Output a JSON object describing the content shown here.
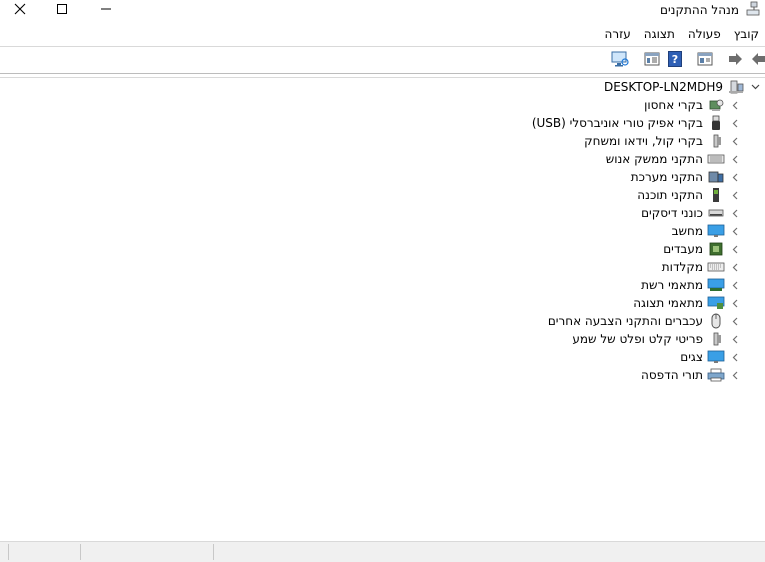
{
  "window": {
    "title": "מנהל ההתקנים",
    "icons": {
      "app": "device-manager-icon",
      "close": "close-icon",
      "maximize": "maximize-icon",
      "minimize": "minimize-icon"
    }
  },
  "menu": {
    "items": [
      "קובץ",
      "פעולה",
      "תצוגה",
      "עזרה"
    ]
  },
  "toolbar": {
    "icons": [
      "back-icon",
      "forward-icon",
      "properties-icon",
      "help-icon",
      "properties-pane-icon",
      "scan-hardware-icon"
    ]
  },
  "tree": {
    "root": {
      "label": "DESKTOP-LN2MDH9",
      "icon": "computer-icon",
      "expanded": true
    },
    "categories": [
      {
        "label": "בקרי אחסון",
        "icon": "storage-controller-icon"
      },
      {
        "label": "בקרי אפיק טורי אוניברסלי (USB)",
        "icon": "usb-icon"
      },
      {
        "label": "בקרי קול, וידאו ומשחק",
        "icon": "speaker-icon"
      },
      {
        "label": "התקני ממשק אנוש",
        "icon": "hid-icon"
      },
      {
        "label": "התקני מערכת",
        "icon": "system-device-icon"
      },
      {
        "label": "התקני תוכנה",
        "icon": "software-device-icon"
      },
      {
        "label": "כונני דיסקים",
        "icon": "disk-drive-icon"
      },
      {
        "label": "מחשב",
        "icon": "monitor-icon"
      },
      {
        "label": "מעבדים",
        "icon": "processor-icon"
      },
      {
        "label": "מקלדות",
        "icon": "keyboard-icon"
      },
      {
        "label": "מתאמי רשת",
        "icon": "network-adapter-icon"
      },
      {
        "label": "מתאמי תצוגה",
        "icon": "display-adapter-icon"
      },
      {
        "label": "עכברים והתקני הצבעה אחרים",
        "icon": "mouse-icon"
      },
      {
        "label": "פריטי קלט ופלט של שמע",
        "icon": "audio-io-icon"
      },
      {
        "label": "צגים",
        "icon": "monitor-icon"
      },
      {
        "label": "תורי הדפסה",
        "icon": "printer-icon"
      }
    ]
  },
  "colors": {
    "accent": "#1e78d7",
    "chevron": "#6f6f6f",
    "statusbar": "#f0f0f0"
  }
}
